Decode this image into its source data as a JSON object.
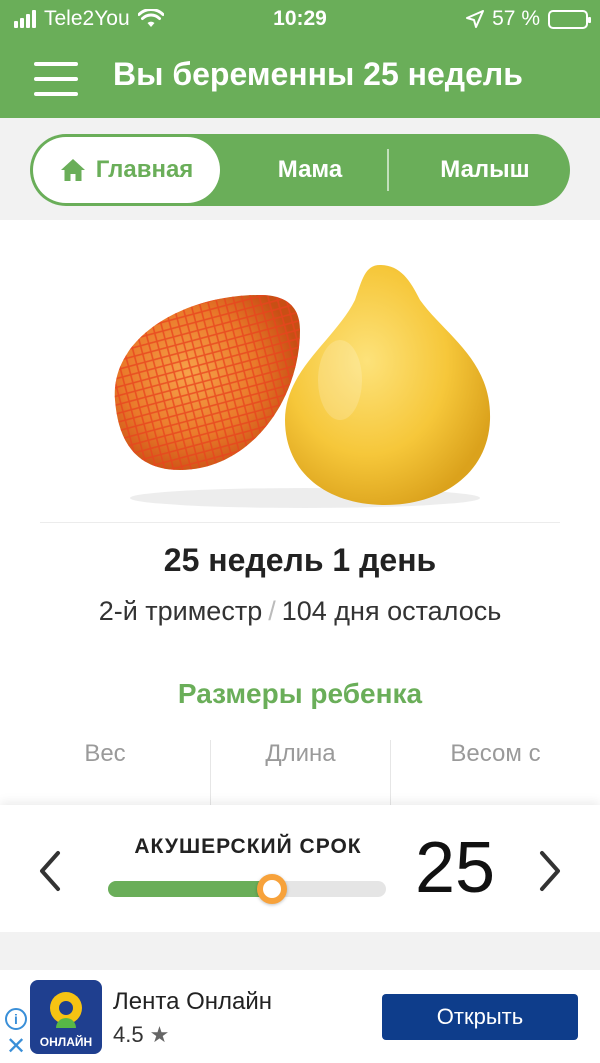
{
  "status_bar": {
    "carrier": "Tele2You",
    "time": "10:29",
    "battery_percent": "57 %",
    "battery_level": 0.57
  },
  "header": {
    "title": "Вы беременны 25 недель"
  },
  "tabs": [
    {
      "label": "Главная",
      "icon": "home-icon",
      "active": true
    },
    {
      "label": "Мама",
      "active": false
    },
    {
      "label": "Малыш",
      "active": false
    }
  ],
  "main": {
    "image": "pomelo-fruit",
    "weeks_days": "25 недель 1 день",
    "trimester": "2-й триместр",
    "days_left": "104 дня осталось",
    "sizes_title": "Размеры ребенка",
    "size_columns": [
      {
        "label": "Вес"
      },
      {
        "label": "Длина"
      },
      {
        "label": "Весом с"
      }
    ]
  },
  "term_panel": {
    "label": "АКУШЕРСКИЙ СРОК",
    "week": "25",
    "progress": 0.59
  },
  "ad": {
    "app_name": "Лента Онлайн",
    "logo_label": "ОНЛАЙН",
    "rating": "4.5",
    "button_label": "Открыть"
  },
  "colors": {
    "brand_green": "#6aae59",
    "slider_thumb": "#f7a23b",
    "ad_button": "#0e3d8b"
  }
}
